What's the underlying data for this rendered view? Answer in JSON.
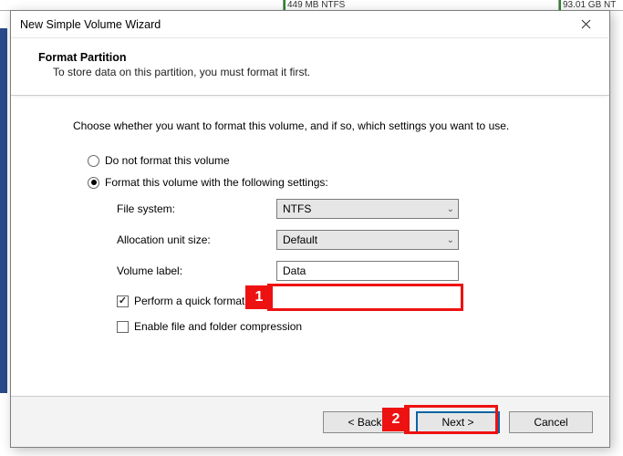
{
  "background": {
    "part1": "449 MB NTFS",
    "part2": "93.01 GB NT"
  },
  "dialog": {
    "title": "New Simple Volume Wizard",
    "header": {
      "title": "Format Partition",
      "desc": "To store data on this partition, you must format it first."
    },
    "instruction": "Choose whether you want to format this volume, and if so, which settings you want to use.",
    "radios": {
      "no_format": "Do not format this volume",
      "format": "Format this volume with the following settings:",
      "selected": "format"
    },
    "fields": {
      "file_system": {
        "label": "File system:",
        "value": "NTFS"
      },
      "alloc_size": {
        "label": "Allocation unit size:",
        "value": "Default"
      },
      "volume_label": {
        "label": "Volume label:",
        "value": "Data"
      }
    },
    "checks": {
      "quick_format": {
        "label": "Perform a quick format",
        "checked": true
      },
      "compression": {
        "label": "Enable file and folder compression",
        "checked": false
      }
    },
    "buttons": {
      "back": "< Back",
      "next": "Next >",
      "cancel": "Cancel"
    }
  },
  "annotations": {
    "n1": "1",
    "n2": "2"
  }
}
